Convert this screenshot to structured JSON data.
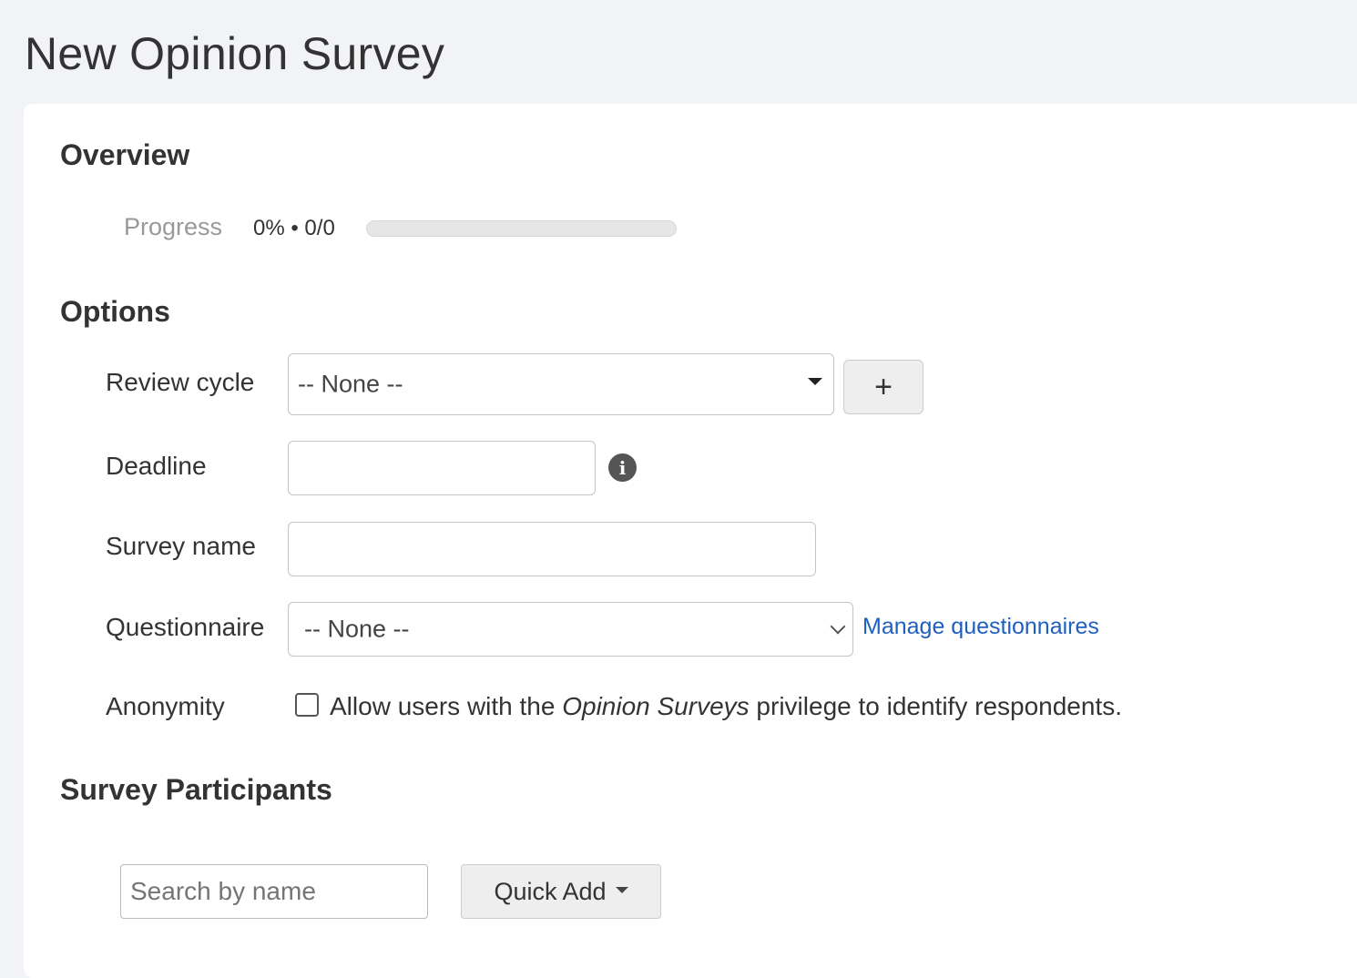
{
  "page": {
    "title": "New Opinion Survey"
  },
  "overview": {
    "heading": "Overview",
    "progress_label": "Progress",
    "progress_text": "0% • 0/0",
    "progress_fraction": 0
  },
  "options": {
    "heading": "Options",
    "review_cycle": {
      "label": "Review cycle",
      "selected": "-- None --",
      "add_label": "+"
    },
    "deadline": {
      "label": "Deadline",
      "value": ""
    },
    "survey_name": {
      "label": "Survey name",
      "value": ""
    },
    "questionnaire": {
      "label": "Questionnaire",
      "selected": "-- None --",
      "manage_link": "Manage questionnaires"
    },
    "anonymity": {
      "label": "Anonymity",
      "checked": false,
      "text_before": "Allow users with the ",
      "text_em": "Opinion Surveys",
      "text_after": " privilege to identify respondents."
    }
  },
  "participants": {
    "heading": "Survey Participants",
    "search_placeholder": "Search by name",
    "quick_add_label": "Quick Add"
  },
  "icons": {
    "info": "info-icon",
    "review_caret": "caret-down-icon",
    "questionnaire_chevron": "chevron-down-icon",
    "quick_add_caret": "caret-down-icon"
  },
  "colors": {
    "link": "#1f5fbf",
    "background": "#f2f3f6",
    "card": "#ffffff"
  }
}
